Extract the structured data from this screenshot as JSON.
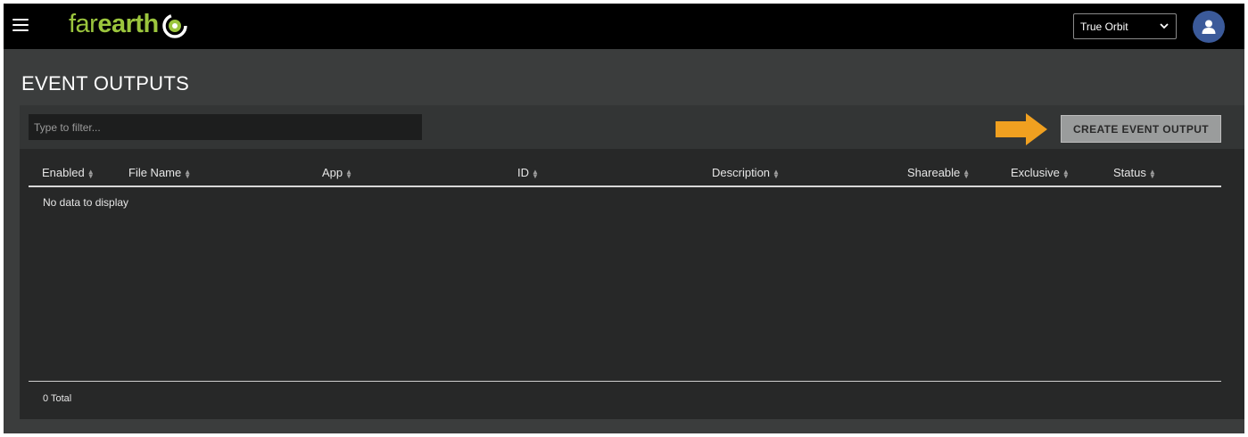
{
  "app": {
    "logo_light": "far",
    "logo_bold": "earth",
    "brand_color": "#9bc53d"
  },
  "topbar": {
    "menu_icon": "hamburger-menu-icon",
    "orbit_selected": "True Orbit",
    "avatar_icon": "user-icon"
  },
  "page": {
    "title": "EVENT OUTPUTS"
  },
  "toolbar": {
    "filter_placeholder": "Type to filter...",
    "filter_value": "",
    "create_label": "CREATE EVENT OUTPUT",
    "arrow_color": "#f0a020"
  },
  "table": {
    "columns": [
      "Enabled",
      "File Name",
      "App",
      "ID",
      "Description",
      "Shareable",
      "Exclusive",
      "Status"
    ],
    "rows": [],
    "empty_text": "No data to display",
    "total_text": "0 Total"
  }
}
